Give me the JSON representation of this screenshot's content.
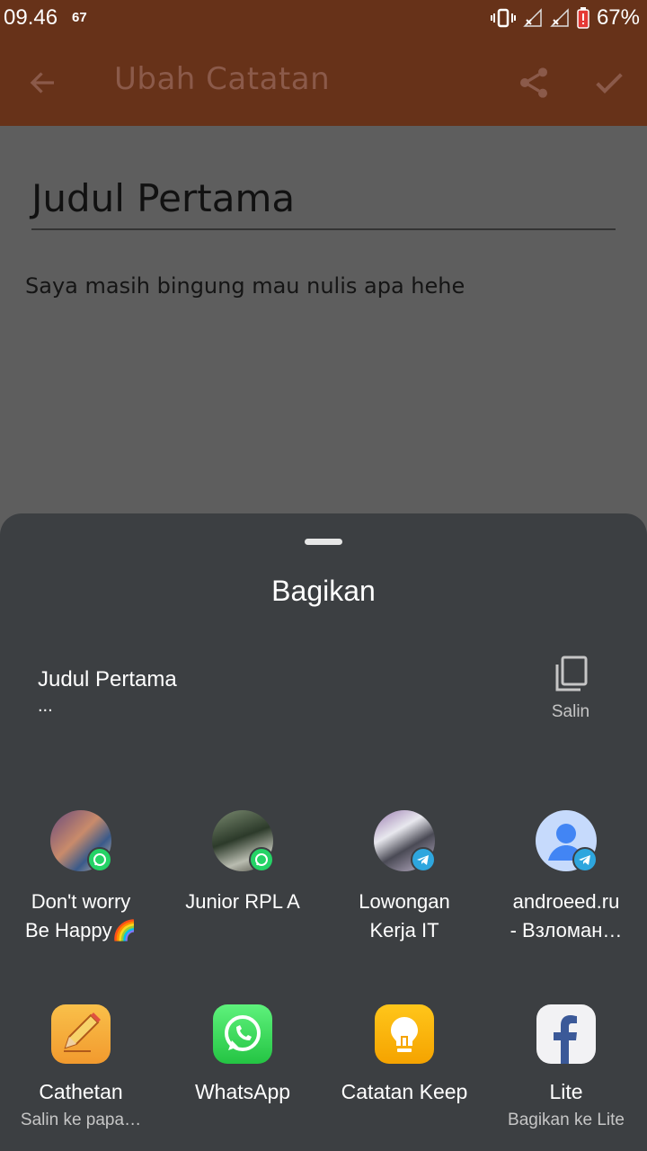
{
  "status_bar": {
    "time": "09.46",
    "notification": "67",
    "battery": "67%"
  },
  "app_bar": {
    "title": "Ubah Catatan"
  },
  "note": {
    "title": "Judul Pertama",
    "body": "Saya masih bingung mau nulis apa hehe"
  },
  "share_sheet": {
    "title": "Bagikan",
    "preview": {
      "title": "Judul Pertama",
      "body": "..."
    },
    "copy_label": "Salin",
    "direct_targets": [
      {
        "line1": "Don't worry",
        "line2": "Be Happy🌈",
        "app": "whatsapp"
      },
      {
        "line1": "Junior RPL A",
        "line2": "",
        "app": "whatsapp"
      },
      {
        "line1": "Lowongan",
        "line2": "Kerja IT",
        "app": "telegram"
      },
      {
        "line1": "androeed.ru",
        "line2": "- Взломан…",
        "app": "telegram"
      }
    ],
    "apps": [
      {
        "label": "Cathetan",
        "sub": "Salin ke papa…",
        "icon": "pencil-icon"
      },
      {
        "label": "WhatsApp",
        "sub": "",
        "icon": "whatsapp-icon"
      },
      {
        "label": "Catatan Keep",
        "sub": "",
        "icon": "lightbulb-icon"
      },
      {
        "label": "Lite",
        "sub": "Bagikan ke Lite",
        "icon": "facebook-icon"
      }
    ]
  },
  "colors": {
    "app_bar": "#673219",
    "sheet": "#3c3f42",
    "whatsapp": "#25d366",
    "telegram": "#2ea6de",
    "keep": "#f6b400"
  }
}
